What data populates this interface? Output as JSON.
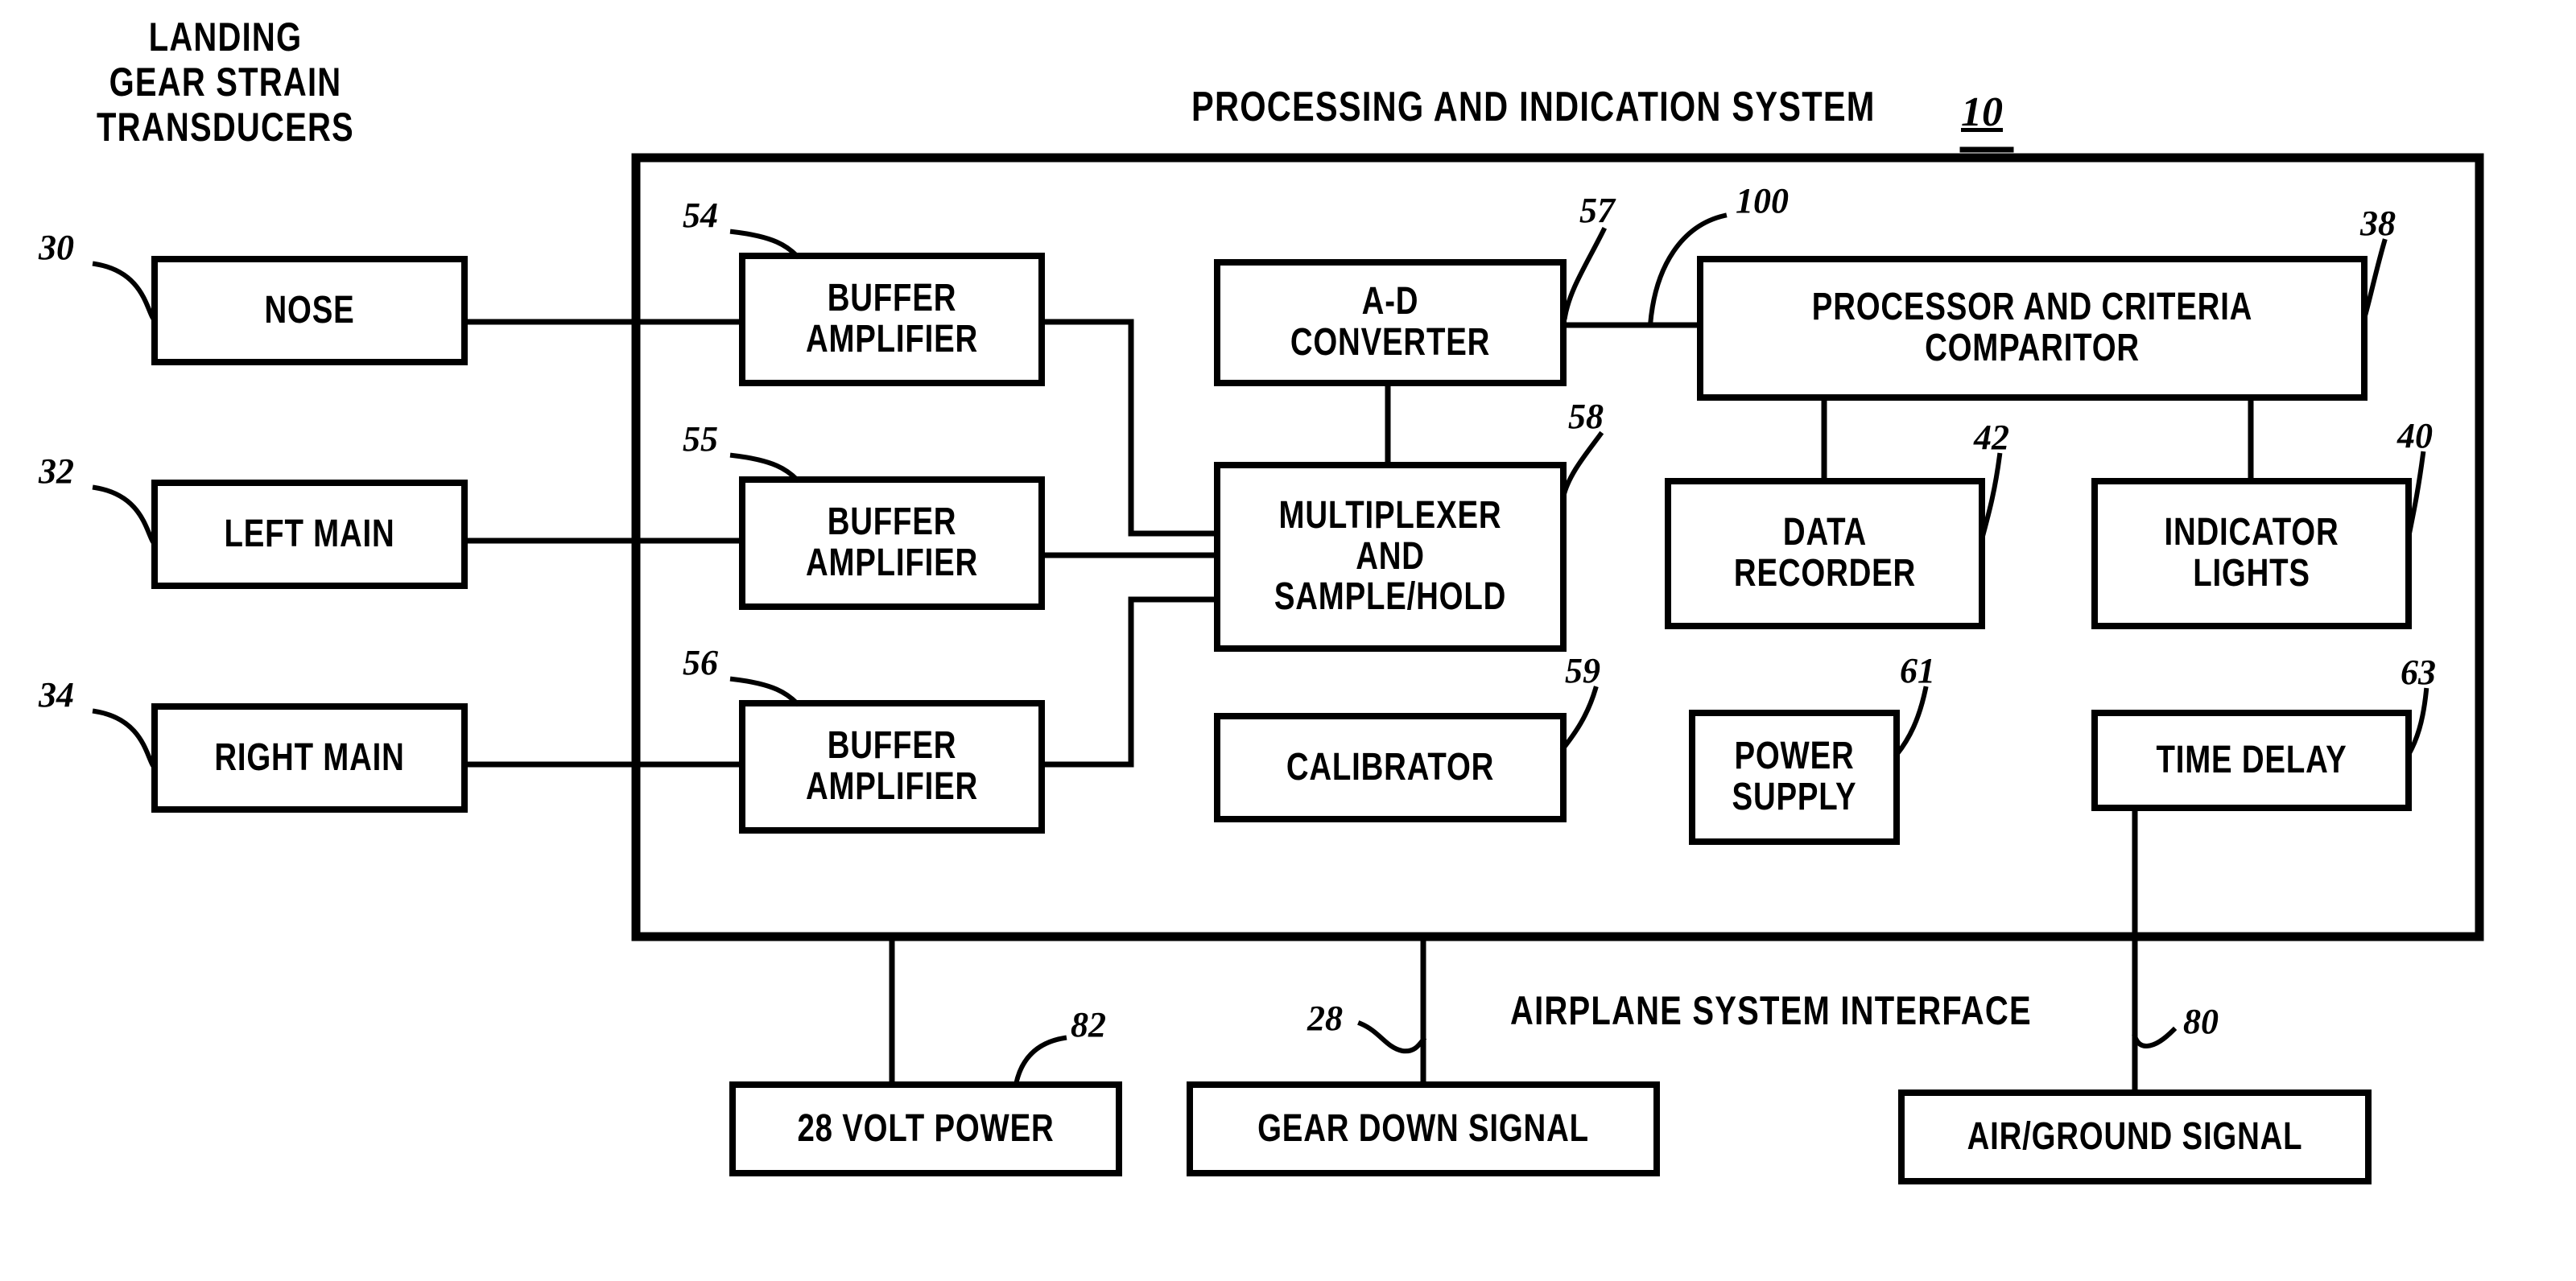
{
  "diagram": {
    "headers": [
      {
        "id": "transducers-header",
        "text": "LANDING\nGEAR STRAIN\nTRANSDUCERS"
      },
      {
        "id": "system-header",
        "text": "PROCESSING AND INDICATION SYSTEM"
      },
      {
        "id": "interface-header",
        "text": "AIRPLANE SYSTEM INTERFACE"
      }
    ],
    "system_header_ref": "10",
    "boxes": [
      {
        "id": "nose",
        "label": "NOSE"
      },
      {
        "id": "left-main",
        "label": "LEFT MAIN"
      },
      {
        "id": "right-main",
        "label": "RIGHT MAIN"
      },
      {
        "id": "buffer-amp-1",
        "label": "BUFFER\nAMPLIFIER"
      },
      {
        "id": "buffer-amp-2",
        "label": "BUFFER\nAMPLIFIER"
      },
      {
        "id": "buffer-amp-3",
        "label": "BUFFER\nAMPLIFIER"
      },
      {
        "id": "ad-converter",
        "label": "A-D\nCONVERTER"
      },
      {
        "id": "multiplexer",
        "label": "MULTIPLEXER\nAND\nSAMPLE/HOLD"
      },
      {
        "id": "calibrator",
        "label": "CALIBRATOR"
      },
      {
        "id": "processor",
        "label": "PROCESSOR AND CRITERIA\nCOMPARITOR"
      },
      {
        "id": "data-recorder",
        "label": "DATA\nRECORDER"
      },
      {
        "id": "indicator-lights",
        "label": "INDICATOR\nLIGHTS"
      },
      {
        "id": "power-supply",
        "label": "POWER\nSUPPLY"
      },
      {
        "id": "time-delay",
        "label": "TIME DELAY"
      },
      {
        "id": "volt-power",
        "label": "28 VOLT POWER"
      },
      {
        "id": "gear-down",
        "label": "GEAR DOWN SIGNAL"
      },
      {
        "id": "air-ground",
        "label": "AIR/GROUND SIGNAL"
      }
    ],
    "reference_numerals": [
      {
        "id": "ref-30",
        "text": "30",
        "target": "nose"
      },
      {
        "id": "ref-32",
        "text": "32",
        "target": "left-main"
      },
      {
        "id": "ref-34",
        "text": "34",
        "target": "right-main"
      },
      {
        "id": "ref-54",
        "text": "54",
        "target": "buffer-amp-1"
      },
      {
        "id": "ref-55",
        "text": "55",
        "target": "buffer-amp-2"
      },
      {
        "id": "ref-56",
        "text": "56",
        "target": "buffer-amp-3"
      },
      {
        "id": "ref-57",
        "text": "57",
        "target": "ad-converter"
      },
      {
        "id": "ref-58",
        "text": "58",
        "target": "multiplexer"
      },
      {
        "id": "ref-59",
        "text": "59",
        "target": "calibrator"
      },
      {
        "id": "ref-100",
        "text": "100",
        "target": "processor-link"
      },
      {
        "id": "ref-38",
        "text": "38",
        "target": "processor"
      },
      {
        "id": "ref-42",
        "text": "42",
        "target": "data-recorder"
      },
      {
        "id": "ref-40",
        "text": "40",
        "target": "indicator-lights"
      },
      {
        "id": "ref-61",
        "text": "61",
        "target": "power-supply"
      },
      {
        "id": "ref-63",
        "text": "63",
        "target": "time-delay"
      },
      {
        "id": "ref-82",
        "text": "82",
        "target": "volt-power"
      },
      {
        "id": "ref-28",
        "text": "28",
        "target": "gear-down"
      },
      {
        "id": "ref-80",
        "text": "80",
        "target": "air-ground"
      }
    ],
    "colors": {
      "ink": "#000000",
      "paper": "#ffffff"
    }
  }
}
